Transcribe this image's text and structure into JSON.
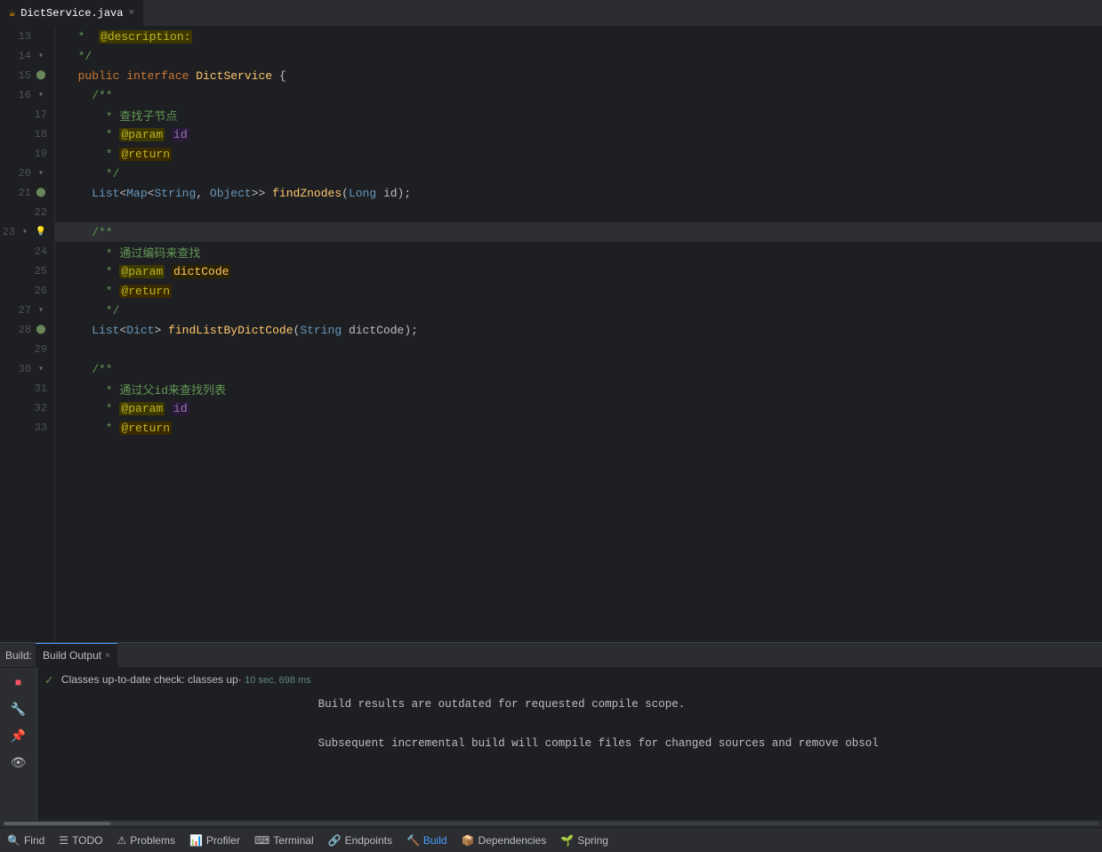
{
  "tab": {
    "filename": "DictService.java",
    "close_label": "×"
  },
  "editor": {
    "lines": [
      {
        "num": 13,
        "gutter": "none",
        "content": "cm",
        "text": "  *  @description:"
      },
      {
        "num": 14,
        "gutter": "fold",
        "content": "cm",
        "text": "  */"
      },
      {
        "num": 15,
        "gutter": "impl",
        "content": "mixed",
        "text": "  public interface DictService {"
      },
      {
        "num": 16,
        "gutter": "fold",
        "content": "cm",
        "text": "    /**"
      },
      {
        "num": 17,
        "gutter": "none",
        "content": "cm",
        "text": "      * 查找子节点"
      },
      {
        "num": 18,
        "gutter": "none",
        "content": "cm_param",
        "text": "      * @param id"
      },
      {
        "num": 19,
        "gutter": "none",
        "content": "cm_return",
        "text": "      * @return"
      },
      {
        "num": 20,
        "gutter": "fold",
        "content": "cm",
        "text": "      */"
      },
      {
        "num": 21,
        "gutter": "impl",
        "content": "method1",
        "text": "    List<Map<String, Object>> findZnodes(Long id);"
      },
      {
        "num": 22,
        "gutter": "none",
        "content": "empty",
        "text": ""
      },
      {
        "num": 23,
        "gutter": "fold_bulb",
        "content": "cm",
        "text": "    /**"
      },
      {
        "num": 24,
        "gutter": "none",
        "content": "cm",
        "text": "      * 通过编码来查找"
      },
      {
        "num": 25,
        "gutter": "none",
        "content": "cm_param2",
        "text": "      * @param dictCode"
      },
      {
        "num": 26,
        "gutter": "none",
        "content": "cm_return",
        "text": "      * @return"
      },
      {
        "num": 27,
        "gutter": "fold",
        "content": "cm",
        "text": "      */"
      },
      {
        "num": 28,
        "gutter": "impl",
        "content": "method2",
        "text": "    List<Dict> findListByDictCode(String dictCode);"
      },
      {
        "num": 29,
        "gutter": "none",
        "content": "empty",
        "text": ""
      },
      {
        "num": 30,
        "gutter": "fold",
        "content": "cm",
        "text": "    /**"
      },
      {
        "num": 31,
        "gutter": "none",
        "content": "cm",
        "text": "      * 通过父id来查找列表"
      },
      {
        "num": 32,
        "gutter": "none",
        "content": "cm_param_id",
        "text": "      * @param id"
      },
      {
        "num": 33,
        "gutter": "none",
        "content": "cm_return",
        "text": "      * @return"
      }
    ]
  },
  "build_panel": {
    "build_label": "Build:",
    "tab_label": "Build Output",
    "tab_close": "×",
    "check_text": "✓",
    "status_label": "Classes up-to-date check:",
    "status_detail": "classes up·",
    "status_time": "10 sec, 698 ms",
    "message_line1": "Build results are outdated for requested compile scope.",
    "message_line2": "Subsequent incremental build will compile files for changed sources and remove obsol"
  },
  "bottom_bar": {
    "items": [
      {
        "icon": "🔍",
        "label": "Find"
      },
      {
        "icon": "☰",
        "label": "TODO"
      },
      {
        "icon": "⚠",
        "label": "Problems"
      },
      {
        "icon": "📊",
        "label": "Profiler"
      },
      {
        "icon": "⌨",
        "label": "Terminal"
      },
      {
        "icon": "🔗",
        "label": "Endpoints"
      },
      {
        "icon": "🔨",
        "label": "Build"
      },
      {
        "icon": "📦",
        "label": "Dependencies"
      },
      {
        "icon": "🌱",
        "label": "Spring"
      }
    ],
    "active_index": 6
  }
}
